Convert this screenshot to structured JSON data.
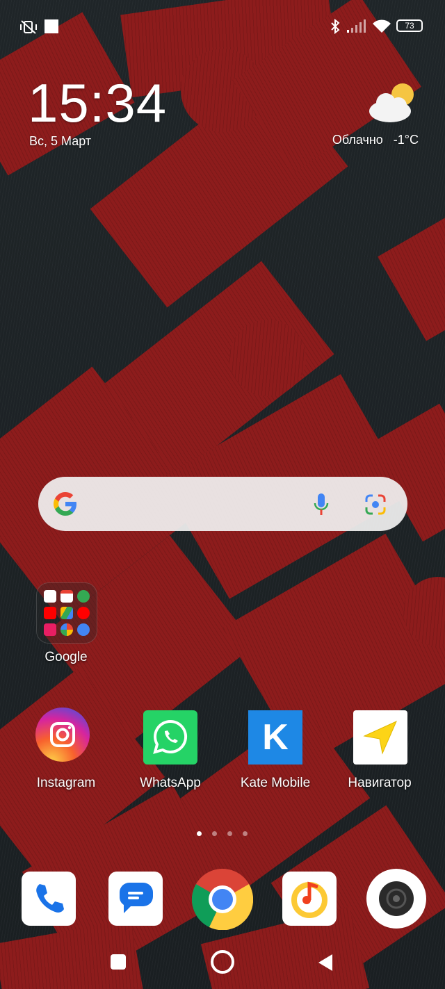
{
  "status_bar": {
    "left_icons": [
      "vibrate-off-icon",
      "notification-square-icon"
    ],
    "right_icons": [
      "bluetooth-icon",
      "signal-icon",
      "wifi-icon",
      "battery-icon"
    ],
    "battery": "73"
  },
  "clock": {
    "time": "15:34",
    "date": "Вс, 5 Март"
  },
  "weather": {
    "condition": "Облачно",
    "temp": "-1°C",
    "icon": "partly-cloudy-icon"
  },
  "search": {
    "logo": "google-g-icon",
    "mic": "mic-icon",
    "lens": "lens-icon"
  },
  "folder": {
    "label": "Google"
  },
  "apps": [
    {
      "label": "Instagram",
      "icon": "instagram-icon"
    },
    {
      "label": "WhatsApp",
      "icon": "whatsapp-icon"
    },
    {
      "label": "Kate Mobile",
      "icon": "kate-mobile-icon",
      "glyph": "K"
    },
    {
      "label": "Навигатор",
      "icon": "navigator-icon"
    }
  ],
  "pager": {
    "pages": 4,
    "current": 1
  },
  "dock": [
    "phone-icon",
    "messages-icon",
    "chrome-icon",
    "music-icon",
    "camera-icon"
  ],
  "nav": [
    "recents-icon",
    "home-icon",
    "back-icon"
  ],
  "colors": {
    "puzzle_red": "#8d1c1c",
    "puzzle_dark": "#1f2528",
    "kate_blue": "#1e88e5",
    "whatsapp_green": "#25d366"
  }
}
